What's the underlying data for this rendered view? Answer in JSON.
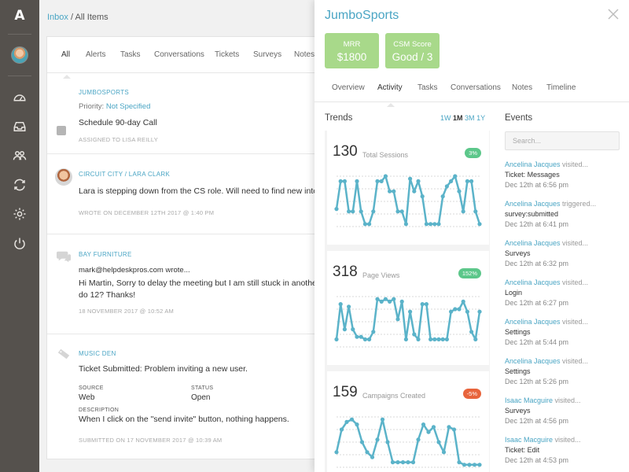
{
  "rail": {
    "logo": "A",
    "icons": [
      "dashboard-icon",
      "inbox-icon",
      "team-icon",
      "sync-icon",
      "settings-icon",
      "power-icon"
    ]
  },
  "breadcrumb": {
    "link": "Inbox",
    "separator": " / ",
    "current": "All Items"
  },
  "list_tabs": [
    "All",
    "Alerts",
    "Tasks",
    "Conversations",
    "Tickets",
    "Surveys",
    "Notes"
  ],
  "items": [
    {
      "source": "JUMBOSPORTS",
      "priority_label": "Priority:",
      "priority_value": "Not Specified",
      "title": "Schedule 90-day Call",
      "meta": "ASSIGNED TO LISA REILLY"
    },
    {
      "source": "CIRCUIT CITY / LARA CLARK",
      "title": "Lara is stepping down from the CS role. Will need to find new inte",
      "meta": "WROTE ON DECEMBER 12TH 2017 @ 1:40 PM"
    },
    {
      "source": "BAY FURNITURE",
      "from": "mark@helpdeskpros.com wrote...",
      "line1": "Hi Martin, Sorry to delay the meeting but I am still stuck in anothe",
      "line2": "do 12? Thanks!",
      "meta": "18 NOVEMBER 2017 @ 10:52 AM"
    },
    {
      "source": "MUSIC DEN",
      "title": "Ticket Submitted: Problem inviting a new user.",
      "source_label": "SOURCE",
      "source_value": "Web",
      "status_label": "STATUS",
      "status_value": "Open",
      "desc_label": "DESCRIPTION",
      "desc_value": "When I click on the \"send invite\" button, nothing happens.",
      "meta": "SUBMITTED ON 17 NOVEMBER 2017 @ 10:39 AM"
    }
  ],
  "panel": {
    "title": "JumboSports",
    "kpis": [
      {
        "label": "MRR",
        "value": "$1800"
      },
      {
        "label": "CSM Score",
        "value": "Good / 3"
      }
    ],
    "tabs": [
      "Overview",
      "Activity",
      "Tasks",
      "Conversations",
      "Notes",
      "Timeline"
    ],
    "active_tab": "Activity",
    "trends_heading": "Trends",
    "ranges": [
      "1W",
      "1M",
      "3M",
      "1Y"
    ],
    "active_range": "1M",
    "events_heading": "Events",
    "search_placeholder": "Search...",
    "colors": {
      "accent": "#4aa5c4",
      "kpi": "#a8d98a",
      "positive": "#5cc78a",
      "negative": "#e8643c",
      "line": "#5bb3c9"
    }
  },
  "trends": [
    {
      "value": "130",
      "label": "Total Sessions",
      "badge": "3%",
      "badge_color": "#5cc78a",
      "series": [
        0.35,
        0.9,
        0.9,
        0.3,
        0.3,
        0.9,
        0.3,
        0.05,
        0.05,
        0.3,
        0.9,
        0.9,
        1.0,
        0.7,
        0.7,
        0.3,
        0.3,
        0.05,
        0.95,
        0.7,
        0.9,
        0.6,
        0.05,
        0.05,
        0.05,
        0.05,
        0.6,
        0.8,
        0.9,
        1.0,
        0.7,
        0.3,
        0.9,
        0.9,
        0.3,
        0.05
      ]
    },
    {
      "value": "318",
      "label": "Page Views",
      "badge": "152%",
      "badge_color": "#5cc78a",
      "series": [
        0.15,
        0.85,
        0.35,
        0.8,
        0.35,
        0.2,
        0.2,
        0.15,
        0.15,
        0.3,
        0.95,
        0.9,
        0.95,
        0.9,
        0.95,
        0.55,
        0.9,
        0.15,
        0.7,
        0.25,
        0.15,
        0.85,
        0.85,
        0.15,
        0.15,
        0.15,
        0.15,
        0.15,
        0.7,
        0.75,
        0.75,
        0.9,
        0.7,
        0.3,
        0.15,
        0.7
      ]
    },
    {
      "value": "159",
      "label": "Campaigns Created",
      "badge": "-5%",
      "badge_color": "#e8643c",
      "series": [
        0.3,
        0.75,
        0.9,
        0.95,
        0.85,
        0.5,
        0.3,
        0.2,
        0.55,
        0.95,
        0.5,
        0.1,
        0.1,
        0.1,
        0.1,
        0.1,
        0.55,
        0.85,
        0.7,
        0.8,
        0.5,
        0.3,
        0.8,
        0.75,
        0.1,
        0.05,
        0.05,
        0.05,
        0.05
      ]
    }
  ],
  "events": [
    {
      "who": "Ancelina Jacques",
      "action": "visited...",
      "what": "Ticket: Messages",
      "when": "Dec 12th at 6:56 pm"
    },
    {
      "who": "Ancelina Jacques",
      "action": "triggered...",
      "what": "survey:submitted",
      "when": "Dec 12th at 6:41 pm"
    },
    {
      "who": "Ancelina Jacques",
      "action": "visited...",
      "what": "Surveys",
      "when": "Dec 12th at 6:32 pm"
    },
    {
      "who": "Ancelina Jacques",
      "action": "visited...",
      "what": "Login",
      "when": "Dec 12th at 6:27 pm"
    },
    {
      "who": "Ancelina Jacques",
      "action": "visited...",
      "what": "Settings",
      "when": "Dec 12th at 5:44 pm"
    },
    {
      "who": "Ancelina Jacques",
      "action": "visited...",
      "what": "Settings",
      "when": "Dec 12th at 5:26 pm"
    },
    {
      "who": "Isaac Macguire",
      "action": "visited...",
      "what": "Surveys",
      "when": "Dec 12th at 4:56 pm"
    },
    {
      "who": "Isaac Macguire",
      "action": "visited...",
      "what": "Ticket: Edit",
      "when": "Dec 12th at 4:53 pm"
    }
  ]
}
